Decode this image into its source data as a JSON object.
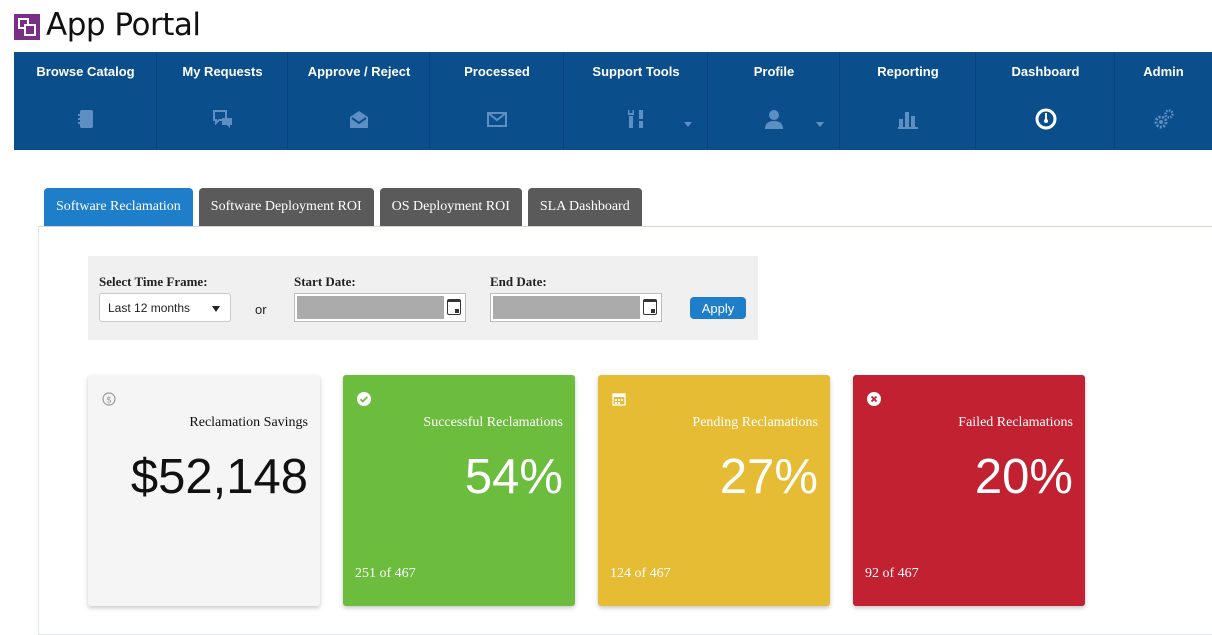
{
  "app": {
    "title": "App Portal"
  },
  "nav": {
    "items": [
      {
        "label": "Browse Catalog",
        "icon": "book-icon"
      },
      {
        "label": "My Requests",
        "icon": "chat-icon"
      },
      {
        "label": "Approve / Reject",
        "icon": "open-envelope-icon"
      },
      {
        "label": "Processed",
        "icon": "envelope-icon"
      },
      {
        "label": "Support Tools",
        "icon": "tools-icon"
      },
      {
        "label": "Profile",
        "icon": "user-icon"
      },
      {
        "label": "Reporting",
        "icon": "bar-chart-icon"
      },
      {
        "label": "Dashboard",
        "icon": "gauge-icon"
      },
      {
        "label": "Admin",
        "icon": "gears-icon"
      }
    ]
  },
  "tabs": [
    {
      "label": "Software Reclamation"
    },
    {
      "label": "Software Deployment ROI"
    },
    {
      "label": "OS Deployment ROI"
    },
    {
      "label": "SLA Dashboard"
    }
  ],
  "filter": {
    "timeframe_label": "Select Time Frame:",
    "timeframe_value": "Last 12 months",
    "or_text": "or",
    "start_label": "Start Date:",
    "end_label": "End Date:",
    "apply_label": "Apply"
  },
  "cards": {
    "savings": {
      "title": "Reclamation Savings",
      "value": "$52,148"
    },
    "success": {
      "title": "Successful Reclamations",
      "value": "54%",
      "count": "251 of 467"
    },
    "pending": {
      "title": "Pending Reclamations",
      "value": "27%",
      "count": "124 of 467"
    },
    "failed": {
      "title": "Failed Reclamations",
      "value": "20%",
      "count": "92 of 467"
    }
  },
  "colors": {
    "nav_bg": "#0b4e8c",
    "tab_active": "#1f7ec9",
    "tab_inactive": "#5a5a5a",
    "success": "#6cbd3e",
    "pending": "#e6bc34",
    "failed": "#c12131"
  }
}
